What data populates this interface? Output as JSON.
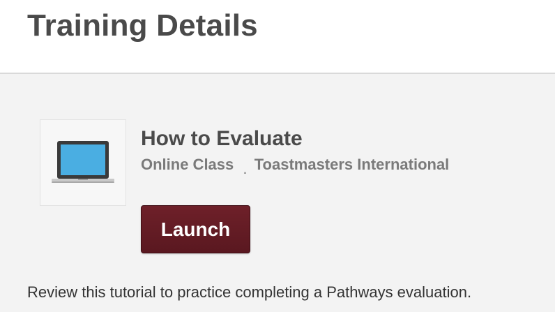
{
  "header": {
    "title": "Training Details"
  },
  "course": {
    "icon": "laptop-icon",
    "title": "How to Evaluate",
    "type": "Online Class",
    "separator": ".",
    "provider": "Toastmasters International",
    "launch_label": "Launch",
    "description": "Review this tutorial to practice completing a Pathways evaluation."
  },
  "colors": {
    "launch_button": "#5e1a22",
    "screen": "#4aaee2"
  }
}
